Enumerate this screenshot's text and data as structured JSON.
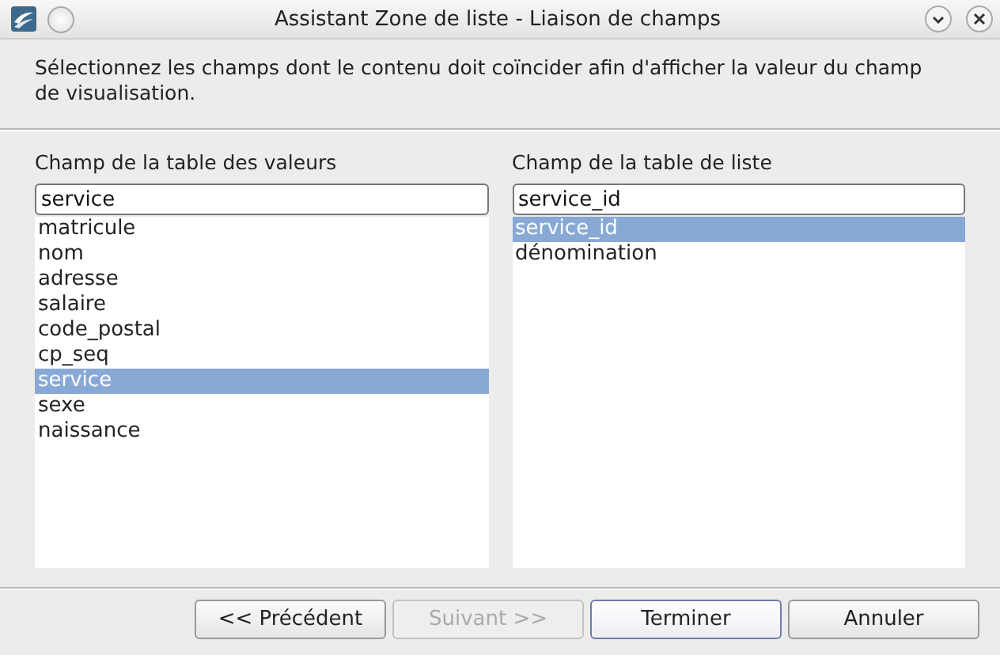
{
  "window": {
    "title": "Assistant Zone de liste - Liaison de champs"
  },
  "description": "Sélectionnez les champs dont le contenu doit coïncider afin d'afficher la valeur du champ de visualisation.",
  "panels": [
    {
      "label": "Champ de la table des valeurs",
      "field": "service",
      "items": [
        {
          "label": "matricule",
          "selected": false
        },
        {
          "label": "nom",
          "selected": false
        },
        {
          "label": "adresse",
          "selected": false
        },
        {
          "label": "salaire",
          "selected": false
        },
        {
          "label": "code_postal",
          "selected": false
        },
        {
          "label": "cp_seq",
          "selected": false
        },
        {
          "label": "service",
          "selected": true
        },
        {
          "label": "sexe",
          "selected": false
        },
        {
          "label": "naissance",
          "selected": false
        }
      ]
    },
    {
      "label": "Champ de la table de liste",
      "field": "service_id",
      "items": [
        {
          "label": "service_id",
          "selected": true
        },
        {
          "label": "dénomination",
          "selected": false
        }
      ]
    }
  ],
  "buttons": [
    {
      "label": "<< Précédent",
      "disabled": false,
      "default": false
    },
    {
      "label": "Suivant >>",
      "disabled": true,
      "default": false
    },
    {
      "label": "Terminer",
      "disabled": false,
      "default": true
    },
    {
      "label": "Annuler",
      "disabled": false,
      "default": false
    }
  ]
}
